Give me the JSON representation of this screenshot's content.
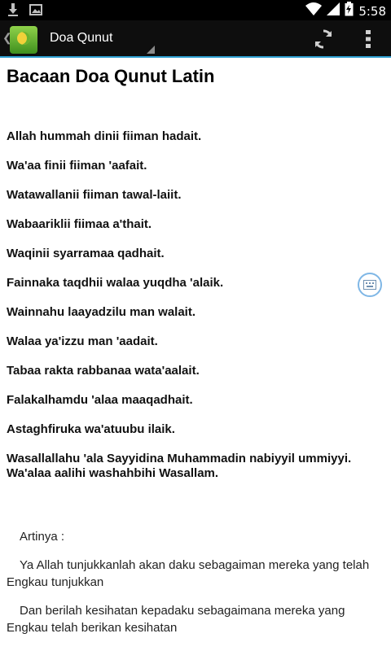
{
  "status_bar": {
    "time": "5:58",
    "icons": [
      "download-icon",
      "image-icon",
      "wifi-icon",
      "signal-icon",
      "battery-charging-icon"
    ]
  },
  "action_bar": {
    "title": "Doa Qunut",
    "accent": "#2e9fd0",
    "icons": [
      "app-logo-icon",
      "refresh-icon",
      "overflow-menu-icon"
    ]
  },
  "content": {
    "heading": "Bacaan Doa Qunut Latin",
    "latin_lines": [
      "Allah hummah dinii fiiman hadait.",
      "Wa'aa finii fiiman 'aafait.",
      "Watawallanii fiiman tawal-laiit.",
      "Wabaariklii fiimaa a'thait.",
      "Waqinii syarramaa qadhait.",
      "Fainnaka taqdhii walaa yuqdha 'alaik.",
      "Wainnahu laayadzilu man walait.",
      "Walaa ya'izzu man 'aadait.",
      "Tabaa rakta rabbanaa wata'aalait.",
      "Falakalhamdu 'alaa maaqadhait.",
      "Astaghfiruka wa'atuubu ilaik.",
      "Wasallallahu 'ala Sayyidina Muhammadin nabiyyil ummiyyi. Wa'alaa aalihi washahbihi Wasallam."
    ],
    "translation": [
      "Artinya :",
      "Ya Allah tunjukkanlah akan daku sebagaiman mereka yang telah Engkau tunjukkan",
      "Dan berilah kesihatan kepadaku sebagaimana mereka yang Engkau telah berikan kesihatan"
    ]
  }
}
